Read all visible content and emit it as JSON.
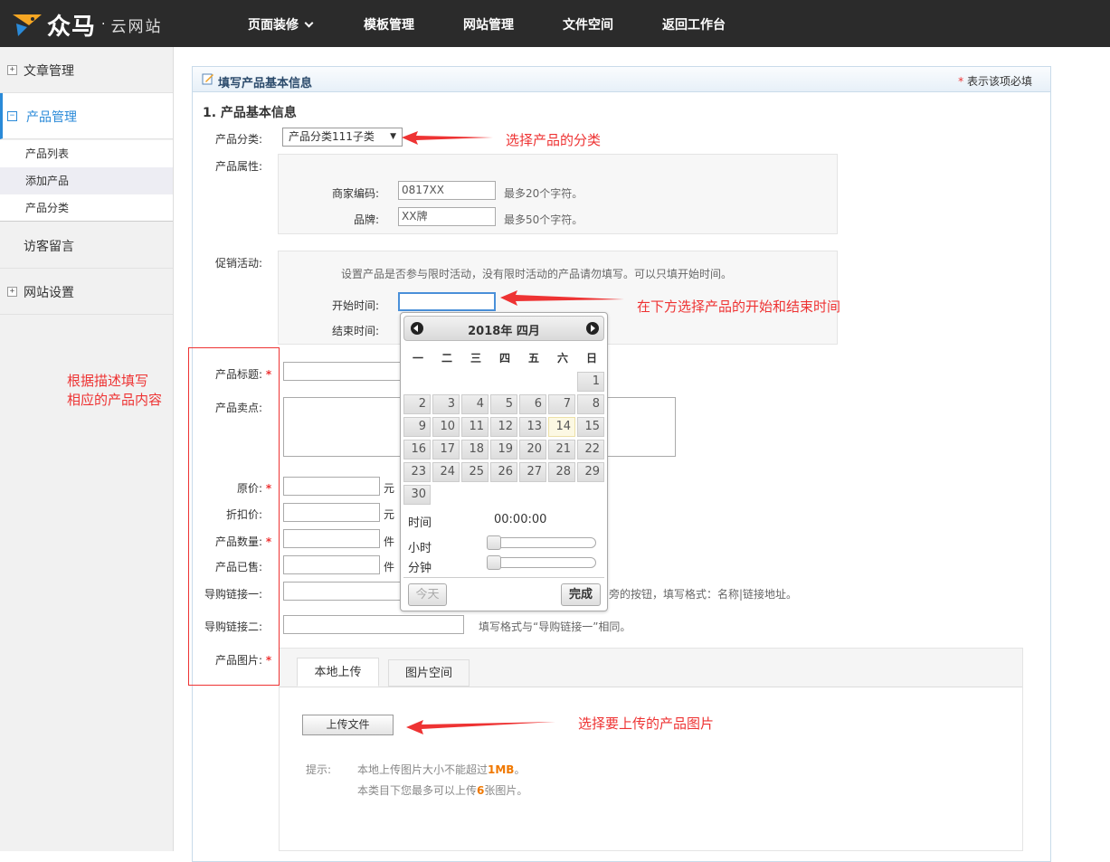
{
  "header": {
    "brand": "众马",
    "brand_sub": "云网站",
    "nav": [
      "页面装修",
      "模板管理",
      "网站管理",
      "文件空间",
      "返回工作台"
    ]
  },
  "sidebar": {
    "items": [
      "文章管理",
      "产品管理",
      "访客留言",
      "网站设置"
    ],
    "sub_items": [
      "产品列表",
      "添加产品",
      "产品分类"
    ]
  },
  "panel": {
    "title": "填写产品基本信息",
    "required_note_star": "*",
    "required_note": "表示该项必填",
    "section": "1. 产品基本信息"
  },
  "form": {
    "category_label": "产品分类:",
    "category_value": "产品分类111子类",
    "attr_label": "产品属性:",
    "merchant_code_label": "商家编码:",
    "merchant_code_value": "0817XX",
    "merchant_code_hint": "最多20个字符。",
    "brand_label": "品牌:",
    "brand_value": "XX牌",
    "brand_hint": "最多50个字符。",
    "promo_label": "促销活动:",
    "promo_hint": "设置产品是否参与限时活动，没有限时活动的产品请勿填写。可以只填开始时间。",
    "start_label": "开始时间:",
    "end_label": "结束时间:",
    "title_label": "产品标题:",
    "selling_label": "产品卖点:",
    "price_label": "原价:",
    "price_unit": "元",
    "discount_label": "折扣价:",
    "discount_unit": "元",
    "qty_label": "产品数量:",
    "qty_unit": "件",
    "sold_label": "产品已售:",
    "sold_unit": "件",
    "link1_label": "导购链接一:",
    "link1_hint": "旁的按钮，填写格式：名称|链接地址。",
    "link2_label": "导购链接二:",
    "link2_hint": "填写格式与“导购链接一”相同。",
    "image_label": "产品图片:",
    "tab_local": "本地上传",
    "tab_space": "图片空间",
    "upload_button": "上传文件",
    "tip_label": "提示:",
    "tip1_pre": "本地上传图片大小不能超过",
    "tip1_strong": "1MB",
    "tip1_post": "。",
    "tip2_pre": "本类目下您最多可以上传",
    "tip2_strong": "6",
    "tip2_post": "张图片。",
    "required_star": "*"
  },
  "datepicker": {
    "title": "2018年 四月",
    "weekdays": [
      "一",
      "二",
      "三",
      "四",
      "五",
      "六",
      "日"
    ],
    "days": [
      "1",
      "2",
      "3",
      "4",
      "5",
      "6",
      "7",
      "8",
      "9",
      "10",
      "11",
      "12",
      "13",
      "14",
      "15",
      "16",
      "17",
      "18",
      "19",
      "20",
      "21",
      "22",
      "23",
      "24",
      "25",
      "26",
      "27",
      "28",
      "29",
      "30"
    ],
    "today": "14",
    "time_label": "时间",
    "time_value": "00:00:00",
    "hour_label": "小时",
    "minute_label": "分钟",
    "today_button": "今天",
    "done_button": "完成"
  },
  "annotations": {
    "category": "选择产品的分类",
    "dates": "在下方选择产品的开始和结束时间",
    "content_line1": "根据描述填写",
    "content_line2": "相应的产品内容",
    "image": "选择要上传的产品图片"
  },
  "colors": {
    "annotation": "#e33333",
    "topbar": "#2b2b2b",
    "accent": "#2a8ad8"
  }
}
